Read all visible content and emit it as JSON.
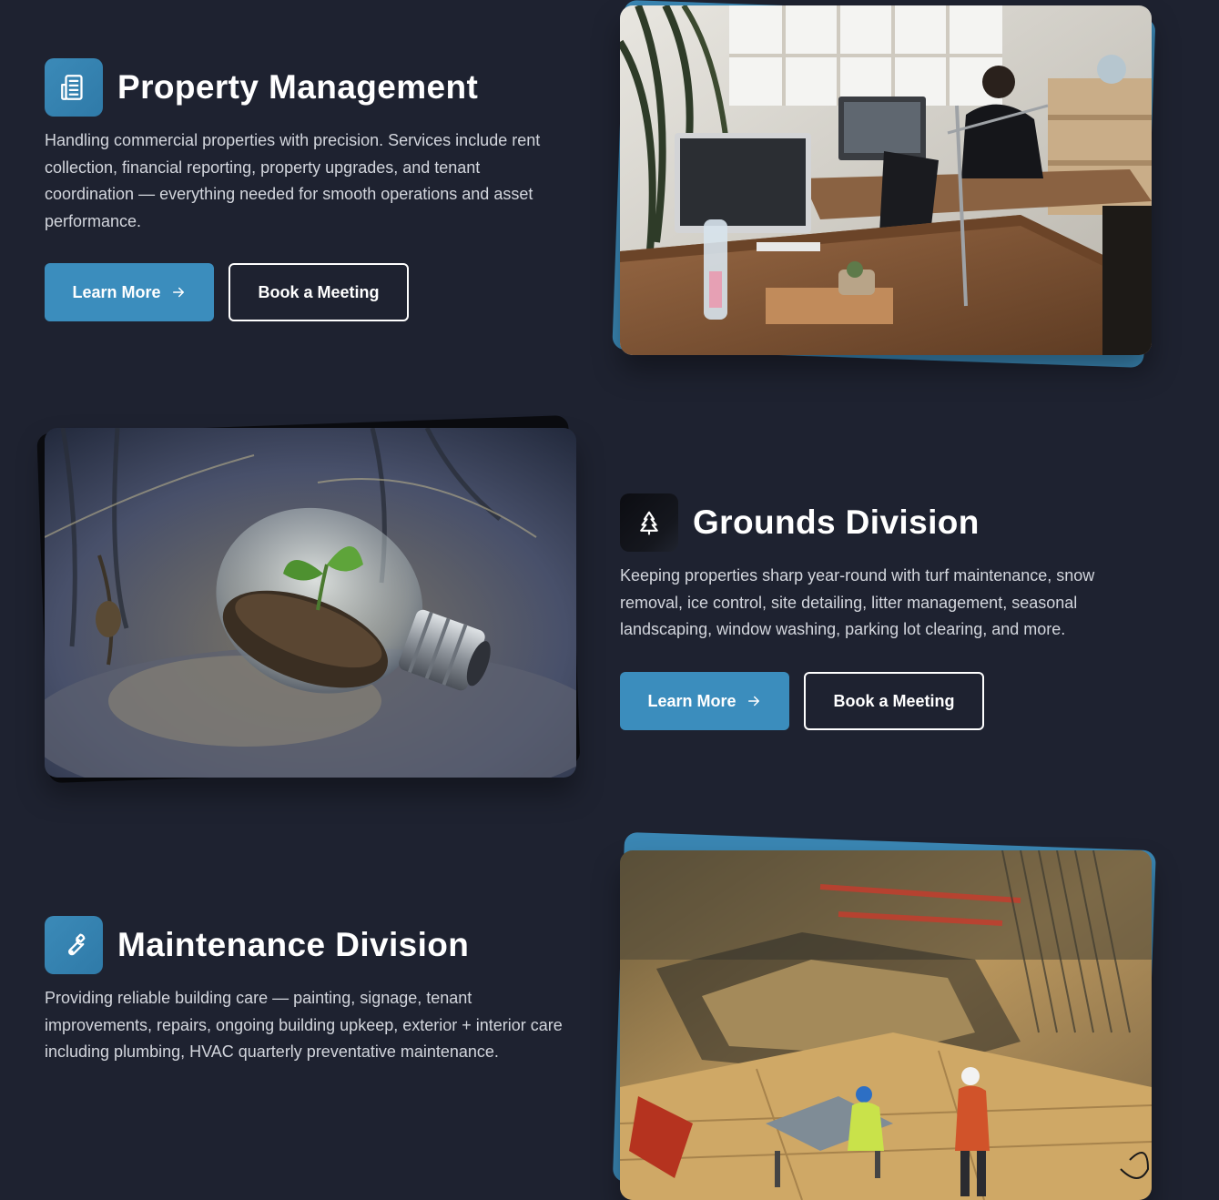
{
  "sections": [
    {
      "icon": "building-document-icon",
      "title": "Property Management",
      "description": "Handling commercial properties with precision. Services include rent collection, financial reporting, property upgrades, and tenant coordination — everything needed for smooth operations and asset performance.",
      "learn_more": "Learn More",
      "book_meeting": "Book a Meeting",
      "image": "office-workspace-photo"
    },
    {
      "icon": "tree-icon",
      "title": "Grounds Division",
      "description": "Keeping properties sharp year-round with turf maintenance, snow removal, ice control, site detailing, litter management, seasonal landscaping, window washing, parking lot clearing, and more.",
      "learn_more": "Learn More",
      "book_meeting": "Book a Meeting",
      "image": "lightbulb-plant-photo"
    },
    {
      "icon": "wrench-icon",
      "title": "Maintenance Division",
      "description": "Providing reliable building care — painting, signage, tenant improvements, repairs, ongoing building upkeep, exterior + interior care including plumbing, HVAC quarterly preventative maintenance.",
      "image": "construction-site-photo"
    }
  ],
  "colors": {
    "background": "#1e2230",
    "accent": "#3b8dbd",
    "text": "#ffffff",
    "body_text": "#d3d6dd"
  }
}
